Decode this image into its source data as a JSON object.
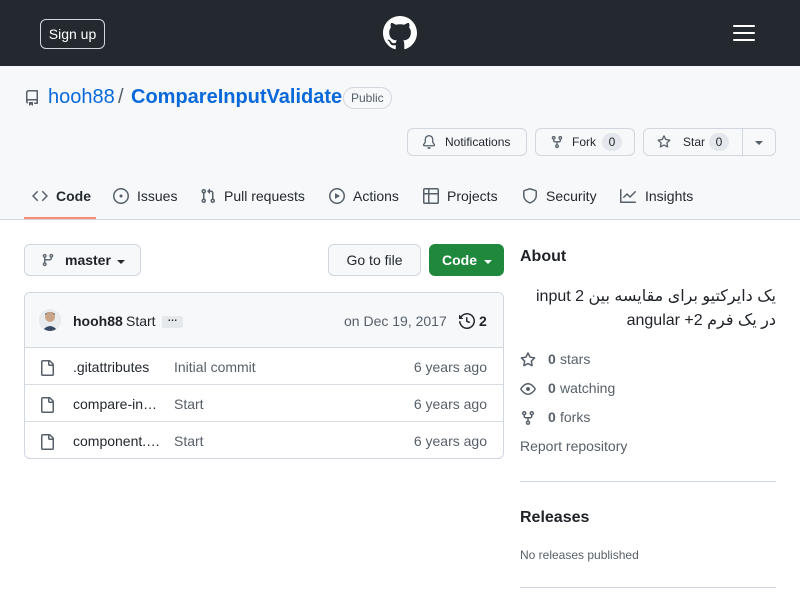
{
  "header": {
    "signup_label": "Sign up",
    "logo_icon": "github-mark-icon",
    "menu_icon": "hamburger-menu-icon"
  },
  "repo": {
    "owner": "hooh88",
    "separator": "/",
    "name": "CompareInputValidate",
    "visibility": "Public"
  },
  "actions": {
    "notifications_label": "Notifications",
    "fork_label": "Fork",
    "fork_count": "0",
    "star_label": "Star",
    "star_count": "0"
  },
  "tabs": [
    {
      "label": "Code",
      "icon": "code-icon",
      "selected": true
    },
    {
      "label": "Issues",
      "icon": "issue-opened-icon"
    },
    {
      "label": "Pull requests",
      "icon": "git-pull-request-icon"
    },
    {
      "label": "Actions",
      "icon": "play-icon"
    },
    {
      "label": "Projects",
      "icon": "table-icon"
    },
    {
      "label": "Security",
      "icon": "shield-icon"
    },
    {
      "label": "Insights",
      "icon": "graph-icon"
    }
  ],
  "toolbar": {
    "branch": "master",
    "goto_file_label": "Go to file",
    "code_label": "Code"
  },
  "commit": {
    "author": "hooh88",
    "message": "Start",
    "ellipsis": "…",
    "date": "on Dec 19, 2017",
    "count": "2"
  },
  "files": [
    {
      "name": ".gitattributes",
      "message": "Initial commit",
      "age": "6 years ago"
    },
    {
      "name": "compare-in…",
      "message": "Start",
      "age": "6 years ago"
    },
    {
      "name": "component.…",
      "message": "Start",
      "age": "6 years ago"
    }
  ],
  "about": {
    "heading": "About",
    "description": "یک دایرکتیو برای مقایسه بین 2 input در یک فرم angular +2",
    "stars_count": "0",
    "stars_label": "stars",
    "watching_count": "0",
    "watching_label": "watching",
    "forks_count": "0",
    "forks_label": "forks",
    "report_label": "Report repository"
  },
  "releases": {
    "heading": "Releases",
    "empty_text": "No releases published"
  },
  "colors": {
    "header_bg": "#24292f",
    "link": "#0969da",
    "primary_button": "#1f883d",
    "tab_underline": "#fd8c73"
  }
}
